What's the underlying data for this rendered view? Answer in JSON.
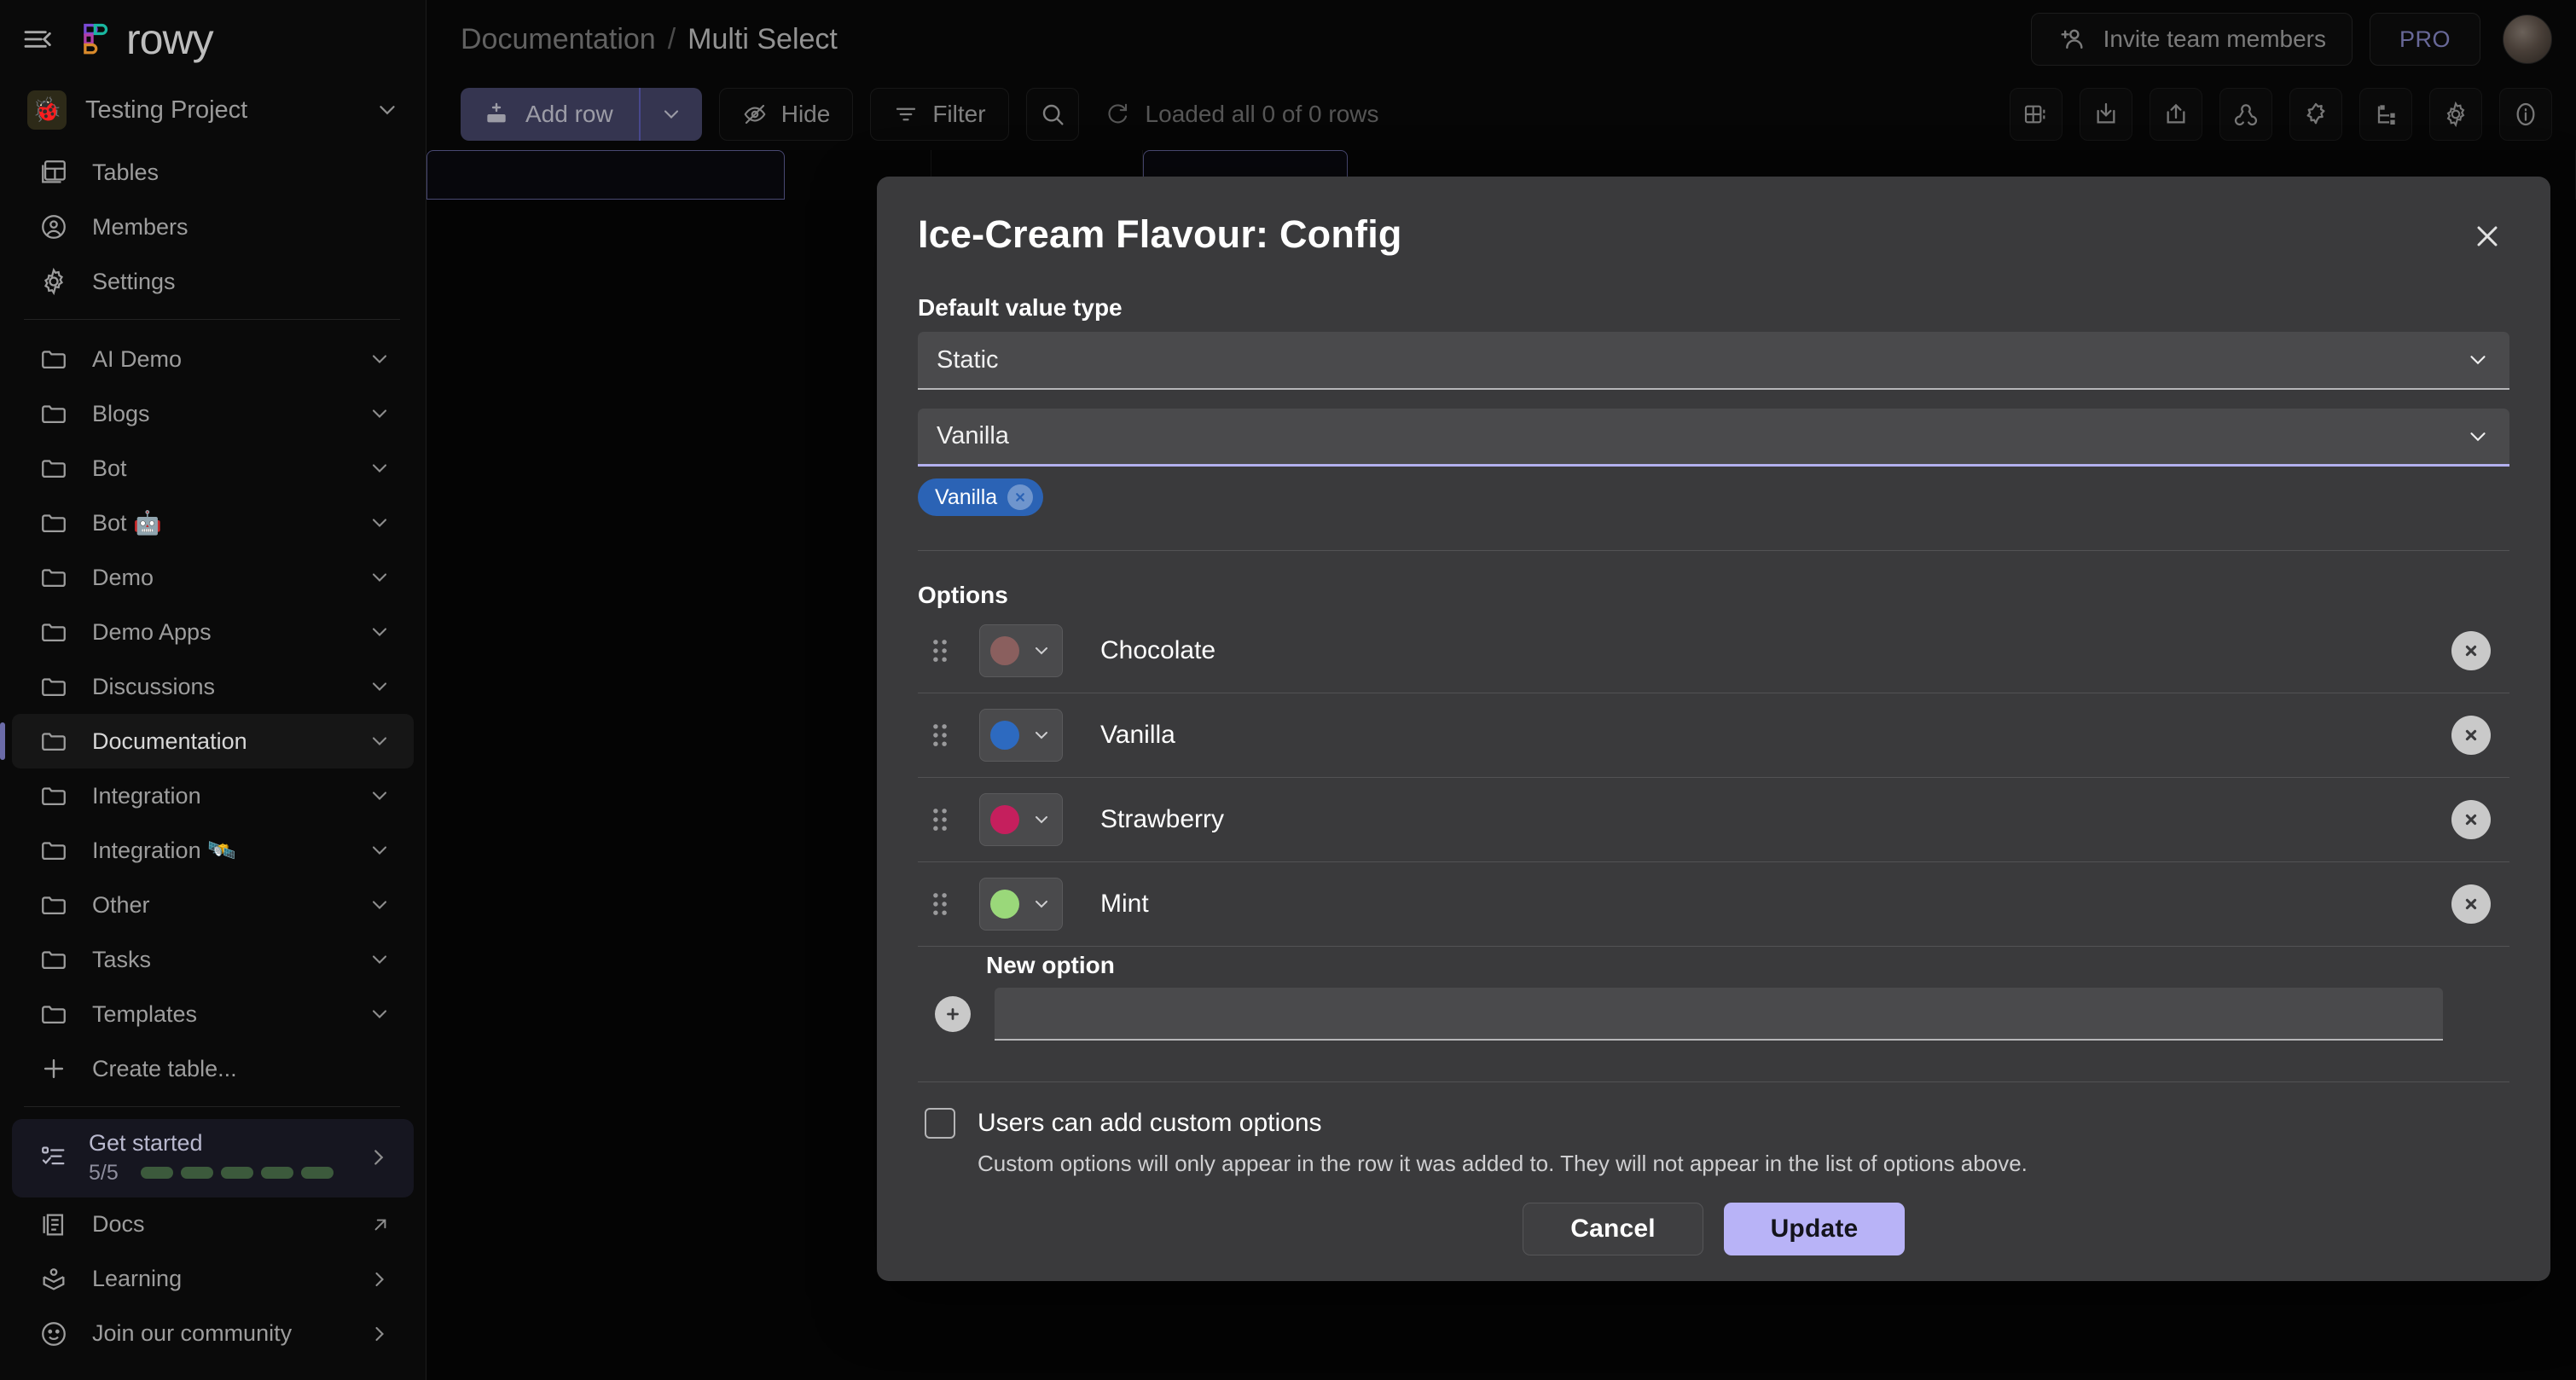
{
  "colors": {
    "accent": "#6b6ba8",
    "update_button": "#b8b3f7",
    "chip": "#2b63b5",
    "pro_text": "#9a9ae0",
    "progress_bar": "#3c5a3c"
  },
  "sidebar": {
    "collapse_icon": "collapse-sidebar-icon",
    "brand": "rowy",
    "project": {
      "name": "Testing Project",
      "avatar_emoji": "🐞",
      "chevron": "chevron-down-icon"
    },
    "primary_items": [
      {
        "label": "Tables",
        "icon": "tables-icon"
      },
      {
        "label": "Members",
        "icon": "members-icon"
      },
      {
        "label": "Settings",
        "icon": "gear-icon"
      }
    ],
    "folders": [
      {
        "label": "AI Demo",
        "icon": "folder-icon",
        "active": false
      },
      {
        "label": "Blogs",
        "icon": "folder-icon",
        "active": false
      },
      {
        "label": "Bot",
        "icon": "folder-icon",
        "active": false
      },
      {
        "label": "Bot 🤖",
        "icon": "folder-icon",
        "active": false
      },
      {
        "label": "Demo",
        "icon": "folder-icon",
        "active": false
      },
      {
        "label": "Demo Apps",
        "icon": "folder-icon",
        "active": false
      },
      {
        "label": "Discussions",
        "icon": "folder-icon",
        "active": false
      },
      {
        "label": "Documentation",
        "icon": "folder-icon",
        "active": true
      },
      {
        "label": "Integration",
        "icon": "folder-icon",
        "active": false
      },
      {
        "label": "Integration 🛰️",
        "icon": "folder-icon",
        "active": false
      },
      {
        "label": "Other",
        "icon": "folder-icon",
        "active": false
      },
      {
        "label": "Tasks",
        "icon": "folder-icon",
        "active": false
      },
      {
        "label": "Templates",
        "icon": "folder-icon",
        "active": false
      }
    ],
    "create_table": {
      "label": "Create table...",
      "icon": "plus-icon"
    },
    "get_started": {
      "title": "Get started",
      "count": "5/5",
      "steps_done": 5,
      "steps_total": 5,
      "icon": "checklist-icon",
      "chevron": "chevron-right-icon"
    },
    "bottom_items": [
      {
        "label": "Docs",
        "icon": "docs-icon",
        "trailing": "external-link-icon"
      },
      {
        "label": "Learning",
        "icon": "learning-icon",
        "trailing": "chevron-right-icon"
      },
      {
        "label": "Join our community",
        "icon": "community-icon",
        "trailing": "chevron-right-icon"
      }
    ]
  },
  "topbar": {
    "breadcrumb": {
      "parent": "Documentation",
      "separator": "/",
      "current": "Multi Select"
    },
    "invite_label": "Invite team members",
    "invite_icon": "person-add-icon",
    "pro_label": "PRO",
    "avatar": "user-avatar"
  },
  "toolbar": {
    "add_row_label": "Add row",
    "add_row_icon": "add-row-icon",
    "add_row_caret": "chevron-down-icon",
    "hide_label": "Hide",
    "hide_icon": "eye-off-icon",
    "filter_label": "Filter",
    "filter_icon": "filter-icon",
    "search_icon": "search-icon",
    "loaded_text": "Loaded all 0 of 0 rows",
    "loaded_icon": "refresh-icon",
    "right_icons": [
      "row-height-icon",
      "import-icon",
      "export-icon",
      "webhooks-icon",
      "extensions-icon",
      "cloud-logs-icon",
      "gear-icon",
      "info-icon"
    ]
  },
  "dialog": {
    "title": "Ice-Cream Flavour: Config",
    "close_icon": "close-icon",
    "default_value_type_label": "Default value type",
    "default_value_type": "Static",
    "default_value": "Vanilla",
    "default_value_chips": [
      {
        "label": "Vanilla",
        "remove_icon": "remove-chip-icon"
      }
    ],
    "options_label": "Options",
    "options": [
      {
        "label": "Chocolate",
        "color": "#8a5f5e",
        "drag": "drag-handle-icon",
        "caret": "chevron-down-icon",
        "delete": "delete-option-icon"
      },
      {
        "label": "Vanilla",
        "color": "#2d6ac0",
        "drag": "drag-handle-icon",
        "caret": "chevron-down-icon",
        "delete": "delete-option-icon"
      },
      {
        "label": "Strawberry",
        "color": "#c51f5d",
        "drag": "drag-handle-icon",
        "caret": "chevron-down-icon",
        "delete": "delete-option-icon"
      },
      {
        "label": "Mint",
        "color": "#9ad87a",
        "drag": "drag-handle-icon",
        "caret": "chevron-down-icon",
        "delete": "delete-option-icon"
      }
    ],
    "new_option_label": "New option",
    "new_option_value": "",
    "new_option_placeholder": "",
    "add_option_icon": "add-option-icon",
    "custom_options_label": "Users can add custom options",
    "custom_options_checked": false,
    "custom_options_help": "Custom options will only appear in the row it was added to. They will not appear in the list of options above.",
    "cancel_label": "Cancel",
    "update_label": "Update"
  }
}
